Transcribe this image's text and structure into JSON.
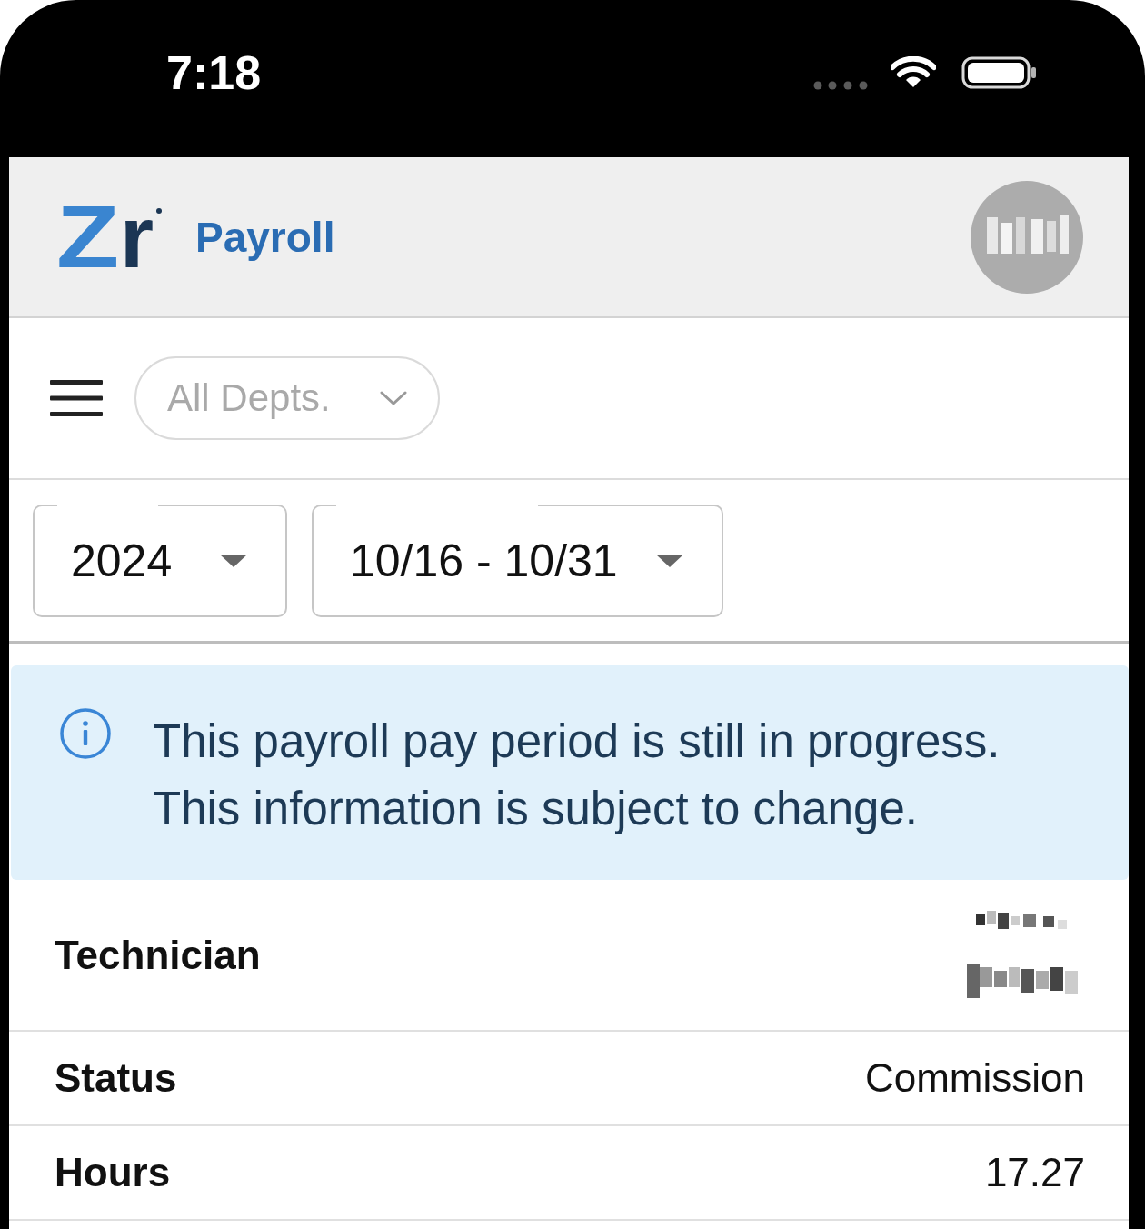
{
  "status_bar": {
    "time": "7:18"
  },
  "header": {
    "logo": "Zr",
    "title": "Payroll"
  },
  "toolbar": {
    "department_filter": {
      "value": "All Depts."
    }
  },
  "period_filters": [
    {
      "value": "2024"
    },
    {
      "value": "10/16 - 10/31"
    }
  ],
  "notice": {
    "kind": "info",
    "message": "This payroll pay period is still in progress. This information is subject to change."
  },
  "details": [
    {
      "label": "Technician",
      "kind": "redacted"
    },
    {
      "label": "Status",
      "kind": "text",
      "value": "Commission"
    },
    {
      "label": "Hours",
      "kind": "text",
      "value": "17.27"
    }
  ]
}
